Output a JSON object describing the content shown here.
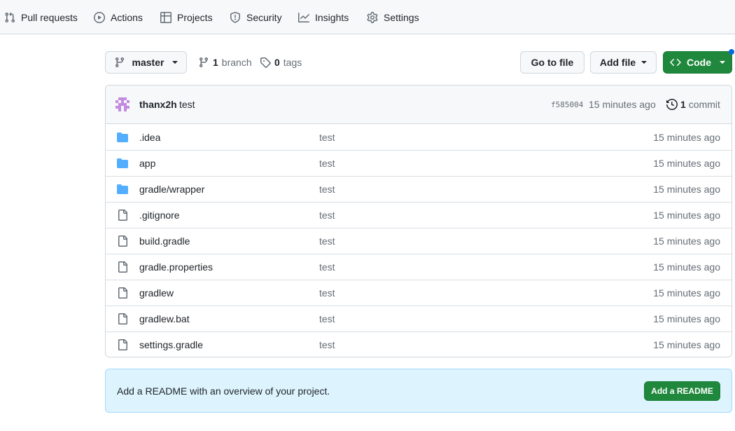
{
  "nav": {
    "items": [
      {
        "label": "Pull requests",
        "icon": "pull-request-icon"
      },
      {
        "label": "Actions",
        "icon": "play-icon"
      },
      {
        "label": "Projects",
        "icon": "table-icon"
      },
      {
        "label": "Security",
        "icon": "shield-icon"
      },
      {
        "label": "Insights",
        "icon": "graph-icon"
      },
      {
        "label": "Settings",
        "icon": "gear-icon"
      }
    ]
  },
  "toolbar": {
    "branch_label": "master",
    "branch_count": "1",
    "branch_word": "branch",
    "tag_count": "0",
    "tag_word": "tags",
    "go_to_file": "Go to file",
    "add_file": "Add file",
    "code": "Code"
  },
  "commit": {
    "author": "thanx2h",
    "message": "test",
    "sha": "f585004",
    "time": "15 minutes ago",
    "count": "1",
    "count_word": "commit"
  },
  "files": [
    {
      "name": ".idea",
      "type": "folder",
      "message": "test",
      "age": "15 minutes ago"
    },
    {
      "name": "app",
      "type": "folder",
      "message": "test",
      "age": "15 minutes ago"
    },
    {
      "name": "gradle/wrapper",
      "type": "folder",
      "message": "test",
      "age": "15 minutes ago"
    },
    {
      "name": ".gitignore",
      "type": "file",
      "message": "test",
      "age": "15 minutes ago"
    },
    {
      "name": "build.gradle",
      "type": "file",
      "message": "test",
      "age": "15 minutes ago"
    },
    {
      "name": "gradle.properties",
      "type": "file",
      "message": "test",
      "age": "15 minutes ago"
    },
    {
      "name": "gradlew",
      "type": "file",
      "message": "test",
      "age": "15 minutes ago"
    },
    {
      "name": "gradlew.bat",
      "type": "file",
      "message": "test",
      "age": "15 minutes ago"
    },
    {
      "name": "settings.gradle",
      "type": "file",
      "message": "test",
      "age": "15 minutes ago"
    }
  ],
  "readme": {
    "text": "Add a README with an overview of your project.",
    "button": "Add a README"
  },
  "colors": {
    "accent_green": "#1f883d",
    "folder_blue": "#54aeff",
    "banner_bg": "#ddf4ff",
    "notification_dot": "#0969da"
  }
}
